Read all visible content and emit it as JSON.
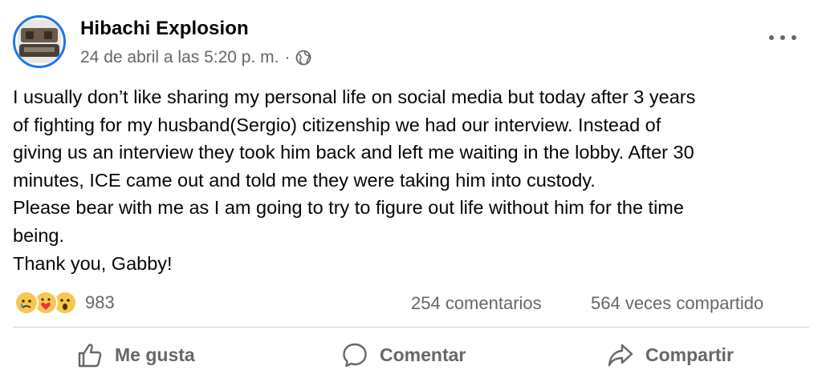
{
  "post": {
    "author": "Hibachi Explosion",
    "timestamp": "24 de abril a las 5:20 p. m.",
    "separator": "·",
    "privacy_icon": "globe-icon",
    "more_icon": "more-options-icon",
    "body_lines": [
      "I usually don’t like sharing my personal life on social media but today after 3 years",
      "of fighting for my husband(Sergio) citizenship we had our interview. Instead of",
      "giving us an interview they took him back and left me waiting in the lobby. After 30",
      "minutes, ICE came out and told me they were taking him into custody.",
      "Please bear with me as I am going to try to figure out life without him for the time",
      "being.",
      "Thank you, Gabby!"
    ]
  },
  "stats": {
    "reaction_icons": [
      "sad-reaction-icon",
      "care-reaction-icon",
      "wow-reaction-icon"
    ],
    "reaction_count": "983",
    "comments": "254 comentarios",
    "shares": "564 veces compartido"
  },
  "actions": {
    "like_label": "Me gusta",
    "comment_label": "Comentar",
    "share_label": "Compartir"
  },
  "colors": {
    "accent": "#1877f2",
    "secondary_text": "#65676b",
    "divider": "#ced0d4",
    "reaction_yellow": "#f7c74f"
  }
}
